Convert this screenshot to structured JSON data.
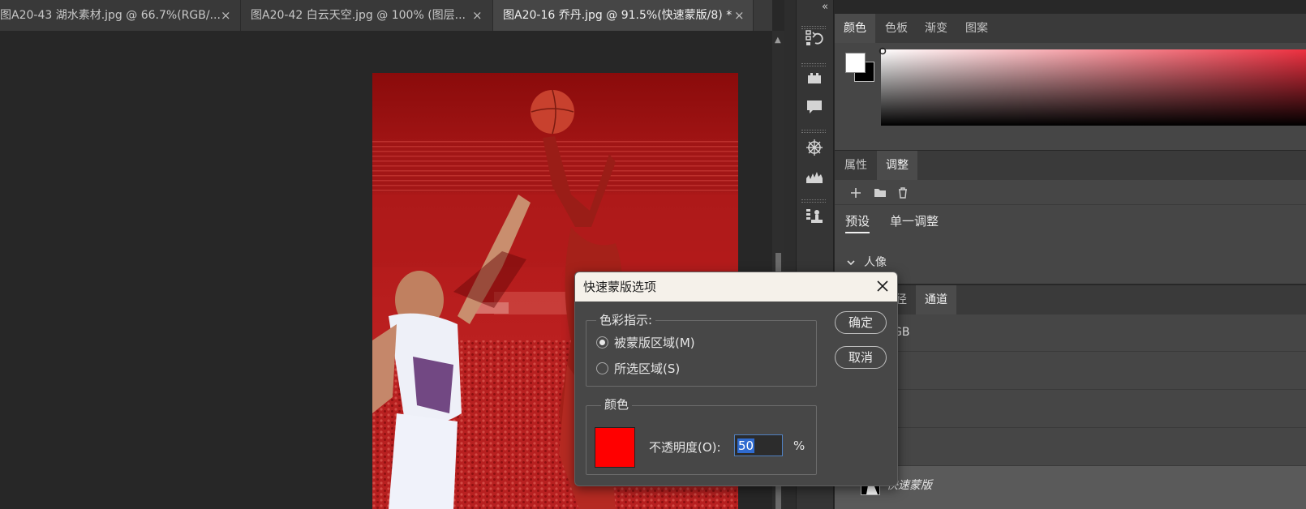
{
  "document_tabs": [
    {
      "label": "图A20-43 湖水素材.jpg @ 66.7%(RGB/...",
      "close": "×",
      "active": false
    },
    {
      "label": "图A20-42 白云天空.jpg @ 100% (图层...",
      "close": "×",
      "active": false
    },
    {
      "label": "图A20-16 乔丹.jpg @ 91.5%(快速蒙版/8) *",
      "close": "×",
      "active": true
    }
  ],
  "toolbar": {
    "collapse_glyph": "«",
    "icons": [
      "history-icon",
      "plugin-icon",
      "comments-icon",
      "shapes-icon",
      "histogram-icon",
      "clone-source-icon"
    ]
  },
  "color_panel": {
    "tabs": [
      "颜色",
      "色板",
      "渐变",
      "图案"
    ],
    "foreground": "#ffffff",
    "background": "#000000",
    "hue_color": "#ee3040"
  },
  "adjust_panel": {
    "tabs": [
      "属性",
      "调整"
    ],
    "subtabs": [
      "预设",
      "单一调整"
    ],
    "section": "人像"
  },
  "channels_panel": {
    "tabs_partial": [
      "径",
      "通道"
    ],
    "rows": [
      "GB",
      "",
      "",
      "",
      "快速蒙版"
    ]
  },
  "dialog": {
    "title": "快速蒙版选项",
    "color_indicates": {
      "legend": "色彩指示:",
      "options": [
        "被蒙版区域(M)",
        "所选区域(S)"
      ],
      "selected_index": 0
    },
    "color_group": {
      "legend": "颜色",
      "swatch_color": "#ff0000",
      "opacity_label": "不透明度(O):",
      "opacity_value": "50",
      "opacity_unit": "%"
    },
    "ok_label": "确定",
    "cancel_label": "取消"
  }
}
